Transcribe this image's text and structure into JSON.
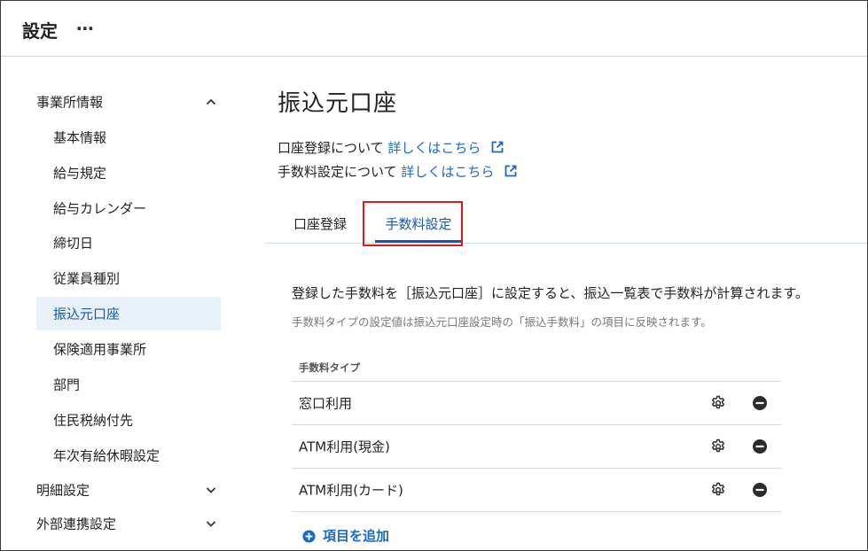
{
  "header": {
    "title": "設定",
    "more_label": "⋯"
  },
  "sidebar": {
    "group_office": "事業所情報",
    "items": [
      "基本情報",
      "給与規定",
      "給与カレンダー",
      "締切日",
      "従業員種別",
      "振込元口座",
      "保険適用事業所",
      "部門",
      "住民税納付先",
      "年次有給休暇設定"
    ],
    "active_item": "振込元口座",
    "group_details": "明細設定",
    "group_integration": "外部連携設定"
  },
  "main": {
    "title": "振込元口座",
    "account_info_text": "口座登録について",
    "fee_info_text": "手数料設定について",
    "details_link": "詳しくはこちら",
    "tabs": [
      "口座登録",
      "手数料設定"
    ],
    "selected_tab": "手数料設定",
    "description": "登録した手数料を［振込元口座］に設定すると、振込一覧表で手数料が計算されます。",
    "note": "手数料タイプの設定値は振込元口座設定時の「振込手数料」の項目に反映されます。",
    "table_header": "手数料タイプ",
    "rows": [
      "窓口利用",
      "ATM利用(現金)",
      "ATM利用(カード)"
    ],
    "add_label": "項目を追加"
  },
  "colors": {
    "accent": "#1a56a8",
    "link": "#1a6ac4",
    "active_bg": "#e8f1fa",
    "highlight": "#e01818"
  }
}
